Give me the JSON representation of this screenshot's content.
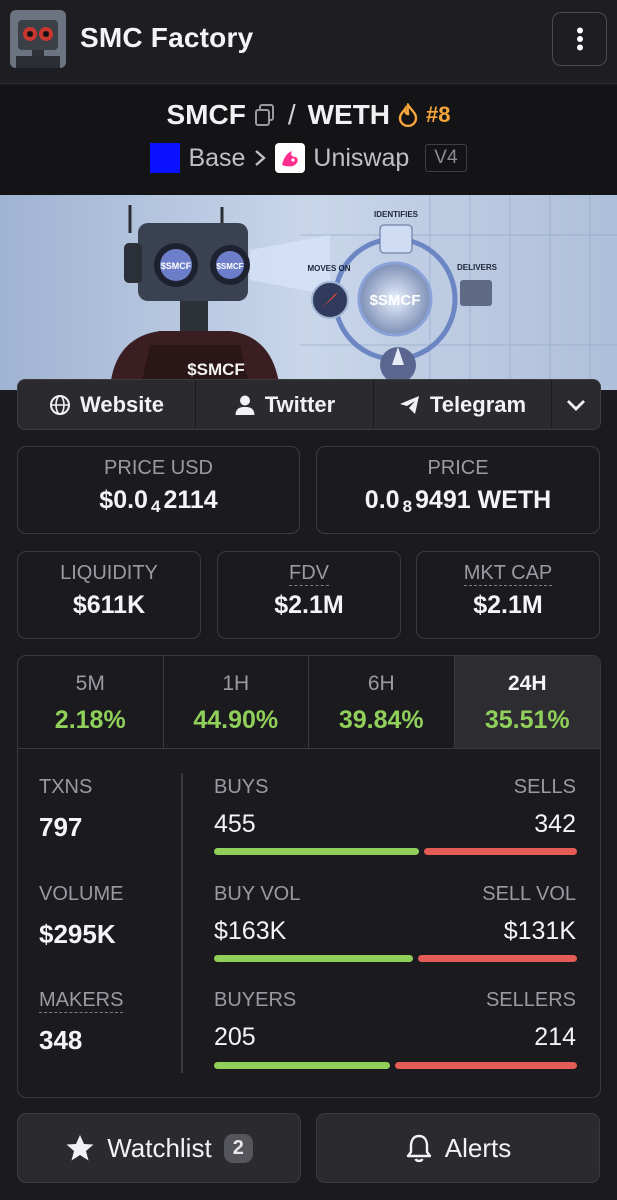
{
  "app": {
    "title": "SMC Factory",
    "logo": "robot-avatar",
    "menu_icon": "vertical-dots-icon"
  },
  "pair": {
    "base": "SMCF",
    "separator": "/",
    "quote": "WETH",
    "rank": "#8",
    "chain": "Base",
    "dex": "Uniswap",
    "version": "V4"
  },
  "banner": {
    "robot_badge": "$SMCF",
    "eye_left": "$SMCF",
    "eye_right": "$SMCF",
    "center": "$SMCF",
    "step_top": "IDENTIFIES",
    "step_right": "DELIVERS",
    "step_left": "MOVES ON"
  },
  "links": {
    "website": "Website",
    "twitter": "Twitter",
    "telegram": "Telegram"
  },
  "price_usd": {
    "label": "PRICE USD",
    "prefix": "$0.0",
    "sub": "4",
    "suffix": "2114"
  },
  "price": {
    "label": "PRICE",
    "prefix": "0.0",
    "sub": "8",
    "suffix": "9491 WETH"
  },
  "liquidity": {
    "label": "LIQUIDITY",
    "value": "$611K"
  },
  "fdv": {
    "label": "FDV",
    "value": "$2.1M"
  },
  "mkt_cap": {
    "label": "MKT CAP",
    "value": "$2.1M"
  },
  "timeframes": [
    {
      "label": "5M",
      "change": "2.18%"
    },
    {
      "label": "1H",
      "change": "44.90%"
    },
    {
      "label": "6H",
      "change": "39.84%"
    },
    {
      "label": "24H",
      "change": "35.51%"
    }
  ],
  "stats": {
    "txns": {
      "label": "TXNS",
      "value": "797"
    },
    "volume": {
      "label": "VOLUME",
      "value": "$295K"
    },
    "makers": {
      "label": "MAKERS",
      "value": "348"
    },
    "buys": {
      "label": "BUYS",
      "value": "455",
      "share": 0.571
    },
    "sells": {
      "label": "SELLS",
      "value": "342"
    },
    "buy_vol": {
      "label": "BUY VOL",
      "value": "$163K",
      "share": 0.554
    },
    "sell_vol": {
      "label": "SELL VOL",
      "value": "$131K"
    },
    "buyers": {
      "label": "BUYERS",
      "value": "205",
      "share": 0.489
    },
    "sellers": {
      "label": "SELLERS",
      "value": "214"
    }
  },
  "actions": {
    "watchlist": "Watchlist",
    "watchlist_count": "2",
    "alerts": "Alerts"
  },
  "colors": {
    "positive": "#8fcf5a",
    "negative": "#e35c56",
    "rank": "#f6a63a",
    "chain": "#0a12ff"
  }
}
